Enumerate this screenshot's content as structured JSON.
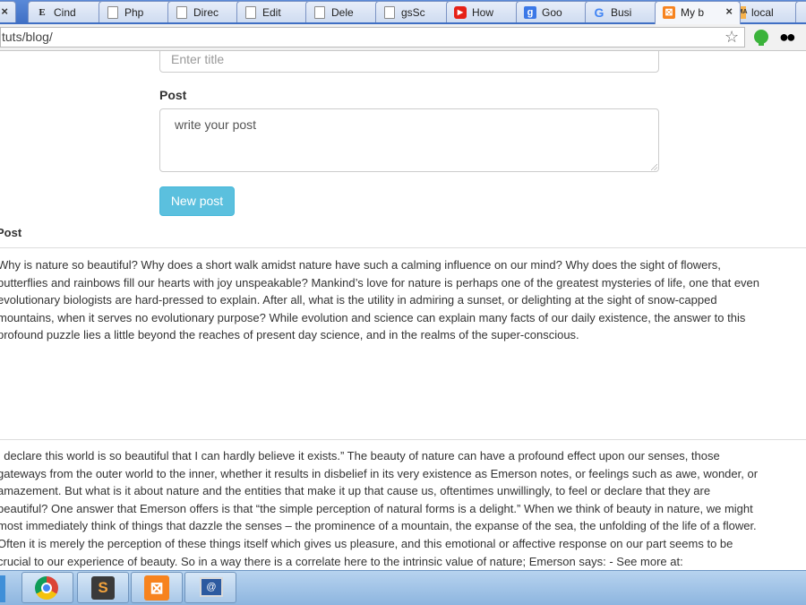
{
  "browser": {
    "tabs": [
      {
        "label": "",
        "icon": "blue-tab-icon",
        "active": false
      },
      {
        "label": "Cind",
        "icon": "e-letter-icon",
        "active": false
      },
      {
        "label": "Php",
        "icon": "document-icon",
        "active": false
      },
      {
        "label": "Direc",
        "icon": "document-icon",
        "active": false
      },
      {
        "label": "Edit",
        "icon": "document-icon",
        "active": false
      },
      {
        "label": "Dele",
        "icon": "document-icon",
        "active": false
      },
      {
        "label": "gsSc",
        "icon": "document-icon",
        "active": false
      },
      {
        "label": "How",
        "icon": "youtube-icon",
        "active": false
      },
      {
        "label": "Goo",
        "icon": "google-icon",
        "active": false
      },
      {
        "label": "Busi",
        "icon": "google-g-icon",
        "active": false
      },
      {
        "label": "My b",
        "icon": "xampp-icon",
        "active": true
      },
      {
        "label": "local",
        "icon": "phpmyadmin-icon",
        "active": false
      }
    ],
    "close_glyph": "×",
    "url": "tuts/blog/"
  },
  "form": {
    "title_placeholder": "Enter title",
    "post_label": "Post",
    "post_placeholder": "write your post",
    "submit_label": "New post"
  },
  "posts_section": {
    "label": "Post",
    "posts": [
      {
        "lines": [
          "Why is nature so beautiful? Why does a short walk amidst nature have such a calming influence on our mind? Why does the sight of flowers,",
          "butterflies and rainbows fill our hearts with joy unspeakable? Mankind’s love for nature is perhaps one of the greatest mysteries of life, one that even",
          "evolutionary biologists are hard-pressed to explain. After all, what is the utility in admiring a sunset, or delighting at the sight of snow-capped",
          "mountains, when it serves no evolutionary purpose? While evolution and science can explain many facts of our daily existence, the answer to this",
          "profound puzzle lies a little beyond the reaches of present day science, and in the realms of the super-conscious."
        ]
      },
      {
        "lines": [
          "I declare this world is so beautiful that I can hardly believe it exists.” The beauty of nature can have a profound effect upon our senses, those",
          "gateways from the outer world to the inner, whether it results in disbelief in its very existence as Emerson notes, or feelings such as awe, wonder, or",
          "amazement. But what is it about nature and the entities that make it up that cause us, oftentimes unwillingly, to feel or declare that they are",
          "beautiful? One answer that Emerson offers is that “the simple perception of natural forms is a delight.” When we think of beauty in nature, we might",
          "most immediately think of things that dazzle the senses – the prominence of a mountain, the expanse of the sea, the unfolding of the life of a flower.",
          "Often it is merely the perception of these things itself which gives us pleasure, and this emotional or affective response on our part seems to be",
          "crucial to our experience of beauty. So in a way there is a correlate here to the intrinsic value of nature; Emerson says: - See more at:"
        ]
      }
    ]
  },
  "taskbar": {
    "items": [
      {
        "name": "chrome",
        "icon": "chrome-icon"
      },
      {
        "name": "sublime-text",
        "icon": "sublime-icon",
        "glyph": "S"
      },
      {
        "name": "xampp",
        "icon": "xampp-icon",
        "glyph": "⊠"
      },
      {
        "name": "app",
        "icon": "app-window-icon",
        "glyph": "@"
      }
    ]
  },
  "colors": {
    "tabstrip": "#4f7fd1",
    "button": "#5bc0de",
    "taskbar": "#9fc3e6"
  }
}
